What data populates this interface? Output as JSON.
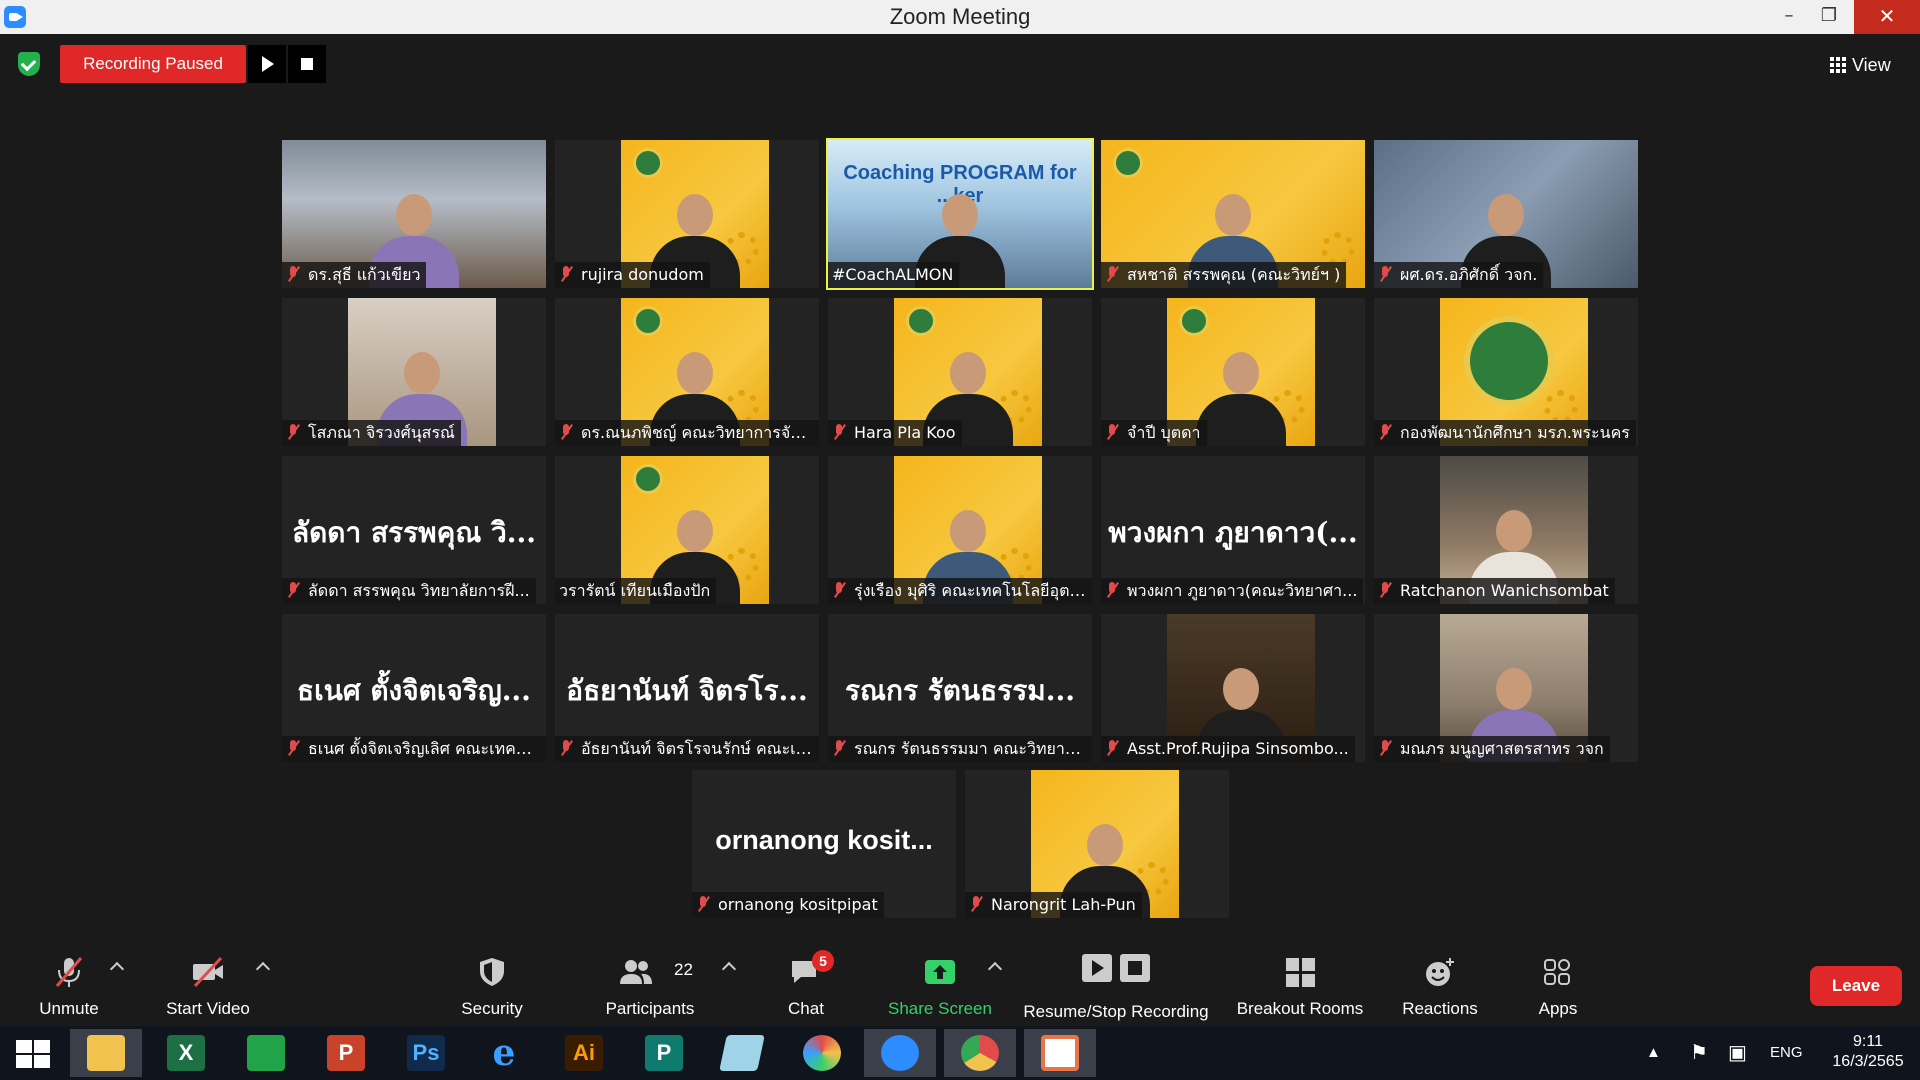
{
  "window": {
    "title": "Zoom Meeting",
    "min": "–",
    "max": "❐",
    "close": "✕"
  },
  "recording": {
    "status": "Recording Paused"
  },
  "view": {
    "label": "View"
  },
  "tiles": [
    {
      "name": "ดร.สุธี  แก้วเขียว"
    },
    {
      "name": "rujira donudom"
    },
    {
      "name": "#CoachALMON",
      "video_text": "Coaching PROGRAM for ...ker"
    },
    {
      "name": "สหชาติ สรรพคุณ (คณะวิทย์ฯ )"
    },
    {
      "name": "ผศ.ดร.อภิศักดิ์ วจก."
    },
    {
      "name": "โสภณา จิรวงศ์นุสรณ์"
    },
    {
      "name": "ดร.ณนภพิชญ์ คณะวิทยาการจัด..."
    },
    {
      "name": "Hara Pla Koo"
    },
    {
      "name": "จำปี บุตดา"
    },
    {
      "name": "กองพัฒนานักศึกษา มรภ.พระนคร"
    },
    {
      "name": "ลัดดา สรรพคุณ วิทยาลัยการฝี...",
      "big_name": "ลัดดา สรรพคุณ วิ..."
    },
    {
      "name": "วรารัตน์ เทียนเมืองปัก"
    },
    {
      "name": "รุ่งเรือง มุศิริ คณะเทคโนโลยีอุตส..."
    },
    {
      "name": "พวงผกา ภูยาดาว(คณะวิทยาศา...",
      "big_name": "พวงผกา ภูยาดาว(..."
    },
    {
      "name": "Ratchanon Wanichsombat"
    },
    {
      "name": "ธเนศ ตั้งจิตเจริญเลิศ คณะเทคโน...",
      "big_name": "ธเนศ ตั้งจิตเจริญ..."
    },
    {
      "name": "อัธยานันท์ จิตรโรจนรักษ์ คณะเท...",
      "big_name": "อัธยานันท์ จิตรโร..."
    },
    {
      "name": "รณกร รัตนธรรมมา คณะวิทยาศ...",
      "big_name": "รณกร รัตนธรรม..."
    },
    {
      "name": "Asst.Prof.Rujipa Sinsombo..."
    },
    {
      "name": "มณภร มนูญศาสตรสาทร วจก"
    },
    {
      "name": "ornanong kositpipat",
      "big_name": "ornanong  kosit..."
    },
    {
      "name": "Narongrit Lah-Pun"
    }
  ],
  "toolbar": {
    "unmute": "Unmute",
    "start_video": "Start Video",
    "security": "Security",
    "participants": "Participants",
    "participants_count": "22",
    "chat": "Chat",
    "chat_badge": "5",
    "share_screen": "Share Screen",
    "resume_stop": "Resume/Stop Recording",
    "breakout": "Breakout Rooms",
    "reactions": "Reactions",
    "apps": "Apps",
    "leave": "Leave",
    "share_color": "#35d06a",
    "leave_color": "#e02828"
  },
  "taskbar": {
    "apps": [
      {
        "name": "file-explorer",
        "glyph": ""
      },
      {
        "name": "excel",
        "glyph": "X"
      },
      {
        "name": "store",
        "glyph": ""
      },
      {
        "name": "powerpoint",
        "glyph": "P"
      },
      {
        "name": "photoshop",
        "glyph": "Ps"
      },
      {
        "name": "internet-explorer",
        "glyph": "e"
      },
      {
        "name": "illustrator",
        "glyph": "Ai"
      },
      {
        "name": "publisher",
        "glyph": "P"
      },
      {
        "name": "notepad",
        "glyph": ""
      },
      {
        "name": "photoscape",
        "glyph": ""
      },
      {
        "name": "zoom",
        "glyph": ""
      },
      {
        "name": "chrome",
        "glyph": ""
      },
      {
        "name": "photos",
        "glyph": ""
      }
    ],
    "language": "ENG",
    "time": "9:11",
    "date": "16/3/2565"
  }
}
